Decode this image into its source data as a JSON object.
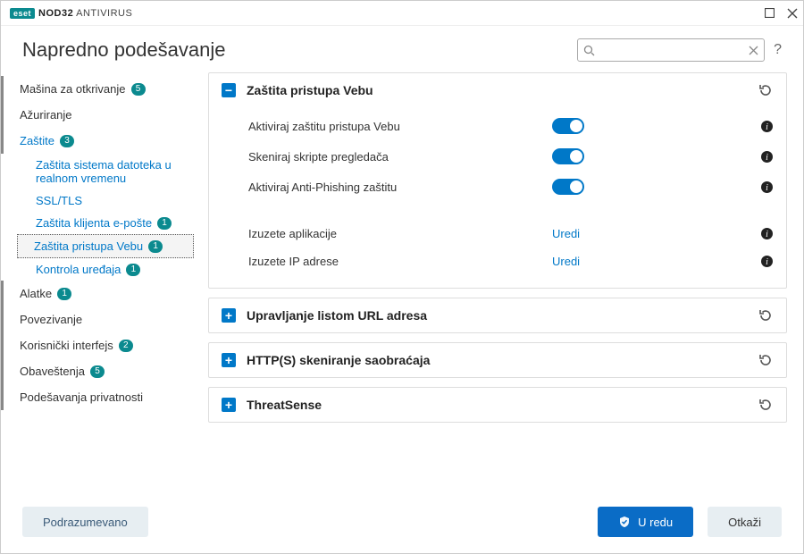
{
  "titlebar": {
    "logo_badge": "eset",
    "logo_text_bold": "NOD32",
    "logo_text_rest": " ANTIVIRUS"
  },
  "header": {
    "title": "Napredno podešavanje",
    "search_placeholder": "",
    "help": "?"
  },
  "sidebar": {
    "items": [
      {
        "label": "Mašina za otkrivanje",
        "badge": "5"
      },
      {
        "label": "Ažuriranje",
        "badge": ""
      },
      {
        "label": "Zaštite",
        "badge": "3"
      },
      {
        "label": "Zaštita sistema datoteka u realnom vremenu",
        "badge": "",
        "sub": true
      },
      {
        "label": "SSL/TLS",
        "badge": "",
        "sub": true
      },
      {
        "label": "Zaštita klijenta e-pošte",
        "badge": "1",
        "sub": true
      },
      {
        "label": "Zaštita pristupa Vebu",
        "badge": "1",
        "sub": true,
        "selected": true
      },
      {
        "label": "Kontrola uređaja",
        "badge": "1",
        "sub": true
      },
      {
        "label": "Alatke",
        "badge": "1"
      },
      {
        "label": "Povezivanje",
        "badge": ""
      },
      {
        "label": "Korisnički interfejs",
        "badge": "2"
      },
      {
        "label": "Obaveštenja",
        "badge": "5"
      },
      {
        "label": "Podešavanja privatnosti",
        "badge": ""
      }
    ]
  },
  "panels": {
    "web": {
      "title": "Zaštita pristupa Vebu",
      "rows": {
        "enable": "Aktiviraj zaštitu pristupa Vebu",
        "scan_scripts": "Skeniraj skripte pregledača",
        "antiphish": "Aktiviraj Anti-Phishing zaštitu",
        "excl_apps": "Izuzete aplikacije",
        "excl_ips": "Izuzete IP adrese",
        "edit1": "Uredi",
        "edit2": "Uredi"
      }
    },
    "url": {
      "title": "Upravljanje listom URL adresa"
    },
    "http": {
      "title": "HTTP(S) skeniranje saobraćaja"
    },
    "ts": {
      "title": "ThreatSense"
    }
  },
  "footer": {
    "default": "Podrazumevano",
    "ok": "U redu",
    "cancel": "Otkaži"
  }
}
